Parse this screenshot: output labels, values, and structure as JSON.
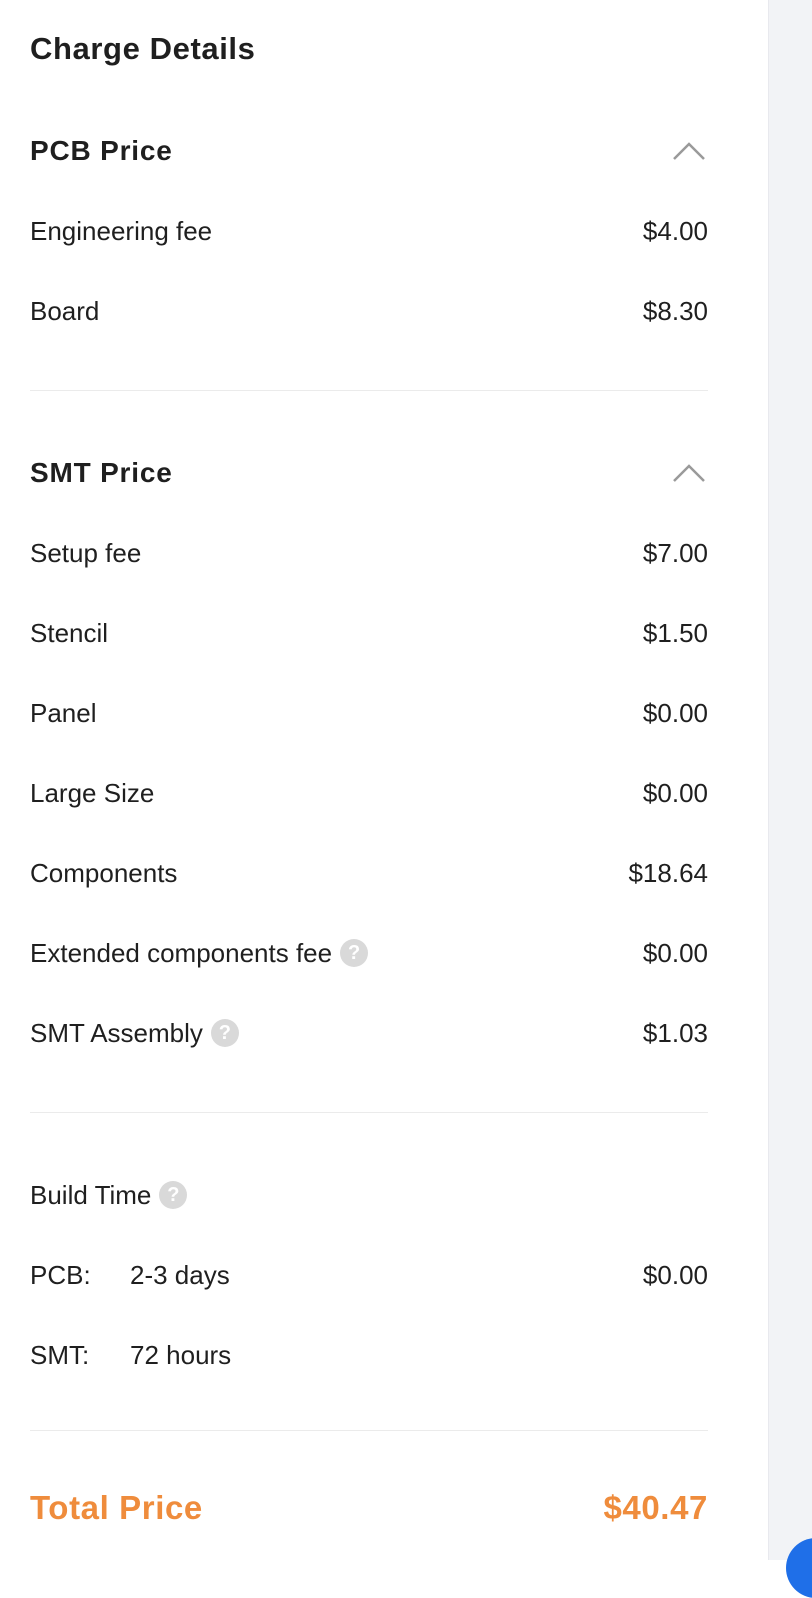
{
  "title": "Charge Details",
  "pcb": {
    "title": "PCB Price",
    "rows": [
      {
        "label": "Engineering fee",
        "value": "$4.00"
      },
      {
        "label": "Board",
        "value": "$8.30"
      }
    ]
  },
  "smt": {
    "title": "SMT Price",
    "rows": [
      {
        "label": "Setup fee",
        "value": "$7.00"
      },
      {
        "label": "Stencil",
        "value": "$1.50"
      },
      {
        "label": "Panel",
        "value": "$0.00"
      },
      {
        "label": "Large Size",
        "value": "$0.00"
      },
      {
        "label": "Components",
        "value": "$18.64"
      },
      {
        "label": "Extended components fee",
        "value": "$0.00"
      },
      {
        "label": "SMT Assembly",
        "value": "$1.03"
      }
    ]
  },
  "build_time": {
    "title": "Build Time",
    "pcb_key": "PCB:",
    "pcb_time": "2-3 days",
    "pcb_value": "$0.00",
    "smt_key": "SMT:",
    "smt_time": "72 hours"
  },
  "total": {
    "label": "Total Price",
    "value": "$40.47"
  },
  "help_glyph": "?",
  "colors": {
    "accent": "#ef8c3c",
    "help_icon": "#d9d9d9",
    "fab": "#1f6fe8"
  }
}
